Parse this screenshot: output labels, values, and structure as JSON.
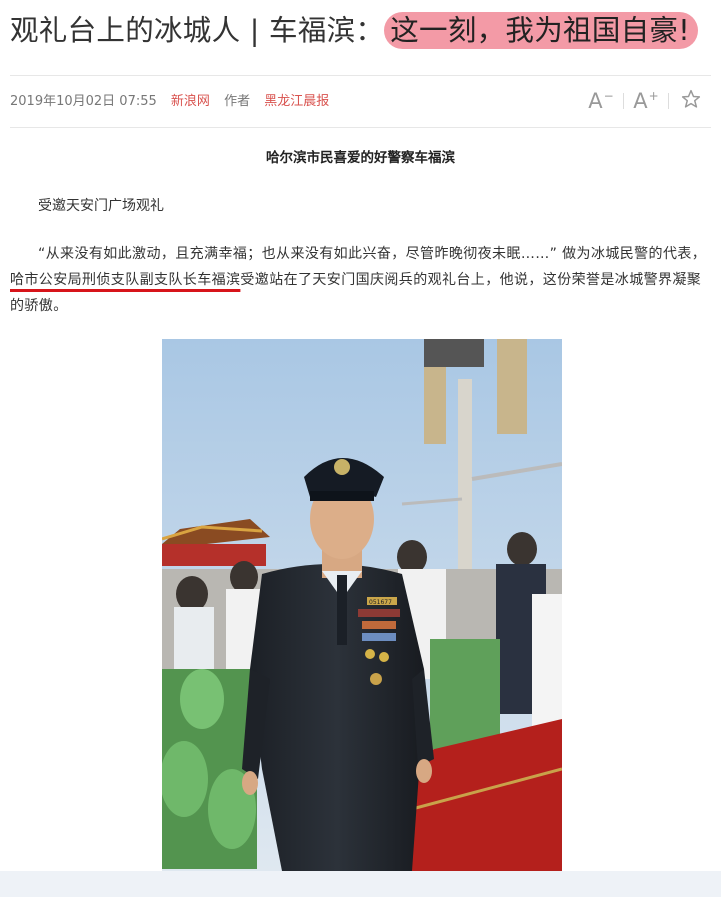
{
  "article": {
    "title_main": "观礼台上的冰城人 | 车福滨：",
    "title_highlight": "这一刻，我为祖国自豪!",
    "date": "2019年10月02日 07:55",
    "source": "新浪网",
    "author_label": "作者",
    "author": "黑龙江晨报",
    "caption": "哈尔滨市民喜爱的好警察车福滨",
    "para1": "受邀天安门广场观礼",
    "para2_before": "“从来没有如此激动，且充满幸福；也从来没有如此兴奋，尽管昨晚彻夜未眠……” 做为冰城民警的代表，",
    "para2_highlight": "哈市公安局刑侦支队副支队长车福滨",
    "para2_after": "受邀站在了天安门国庆阅兵的观礼台上，他说，这份荣誉是冰城警界凝聚的骄傲。"
  },
  "toolbar": {
    "font_decrease": "A",
    "font_decrease_sign": "−",
    "font_increase": "A",
    "font_increase_sign": "+",
    "favorite_icon": "star-icon"
  },
  "photo": {
    "badge_number": "051677"
  },
  "colors": {
    "title_highlight": "#f39aa6",
    "underline": "#d7141a",
    "source_link": "#d9534f"
  }
}
